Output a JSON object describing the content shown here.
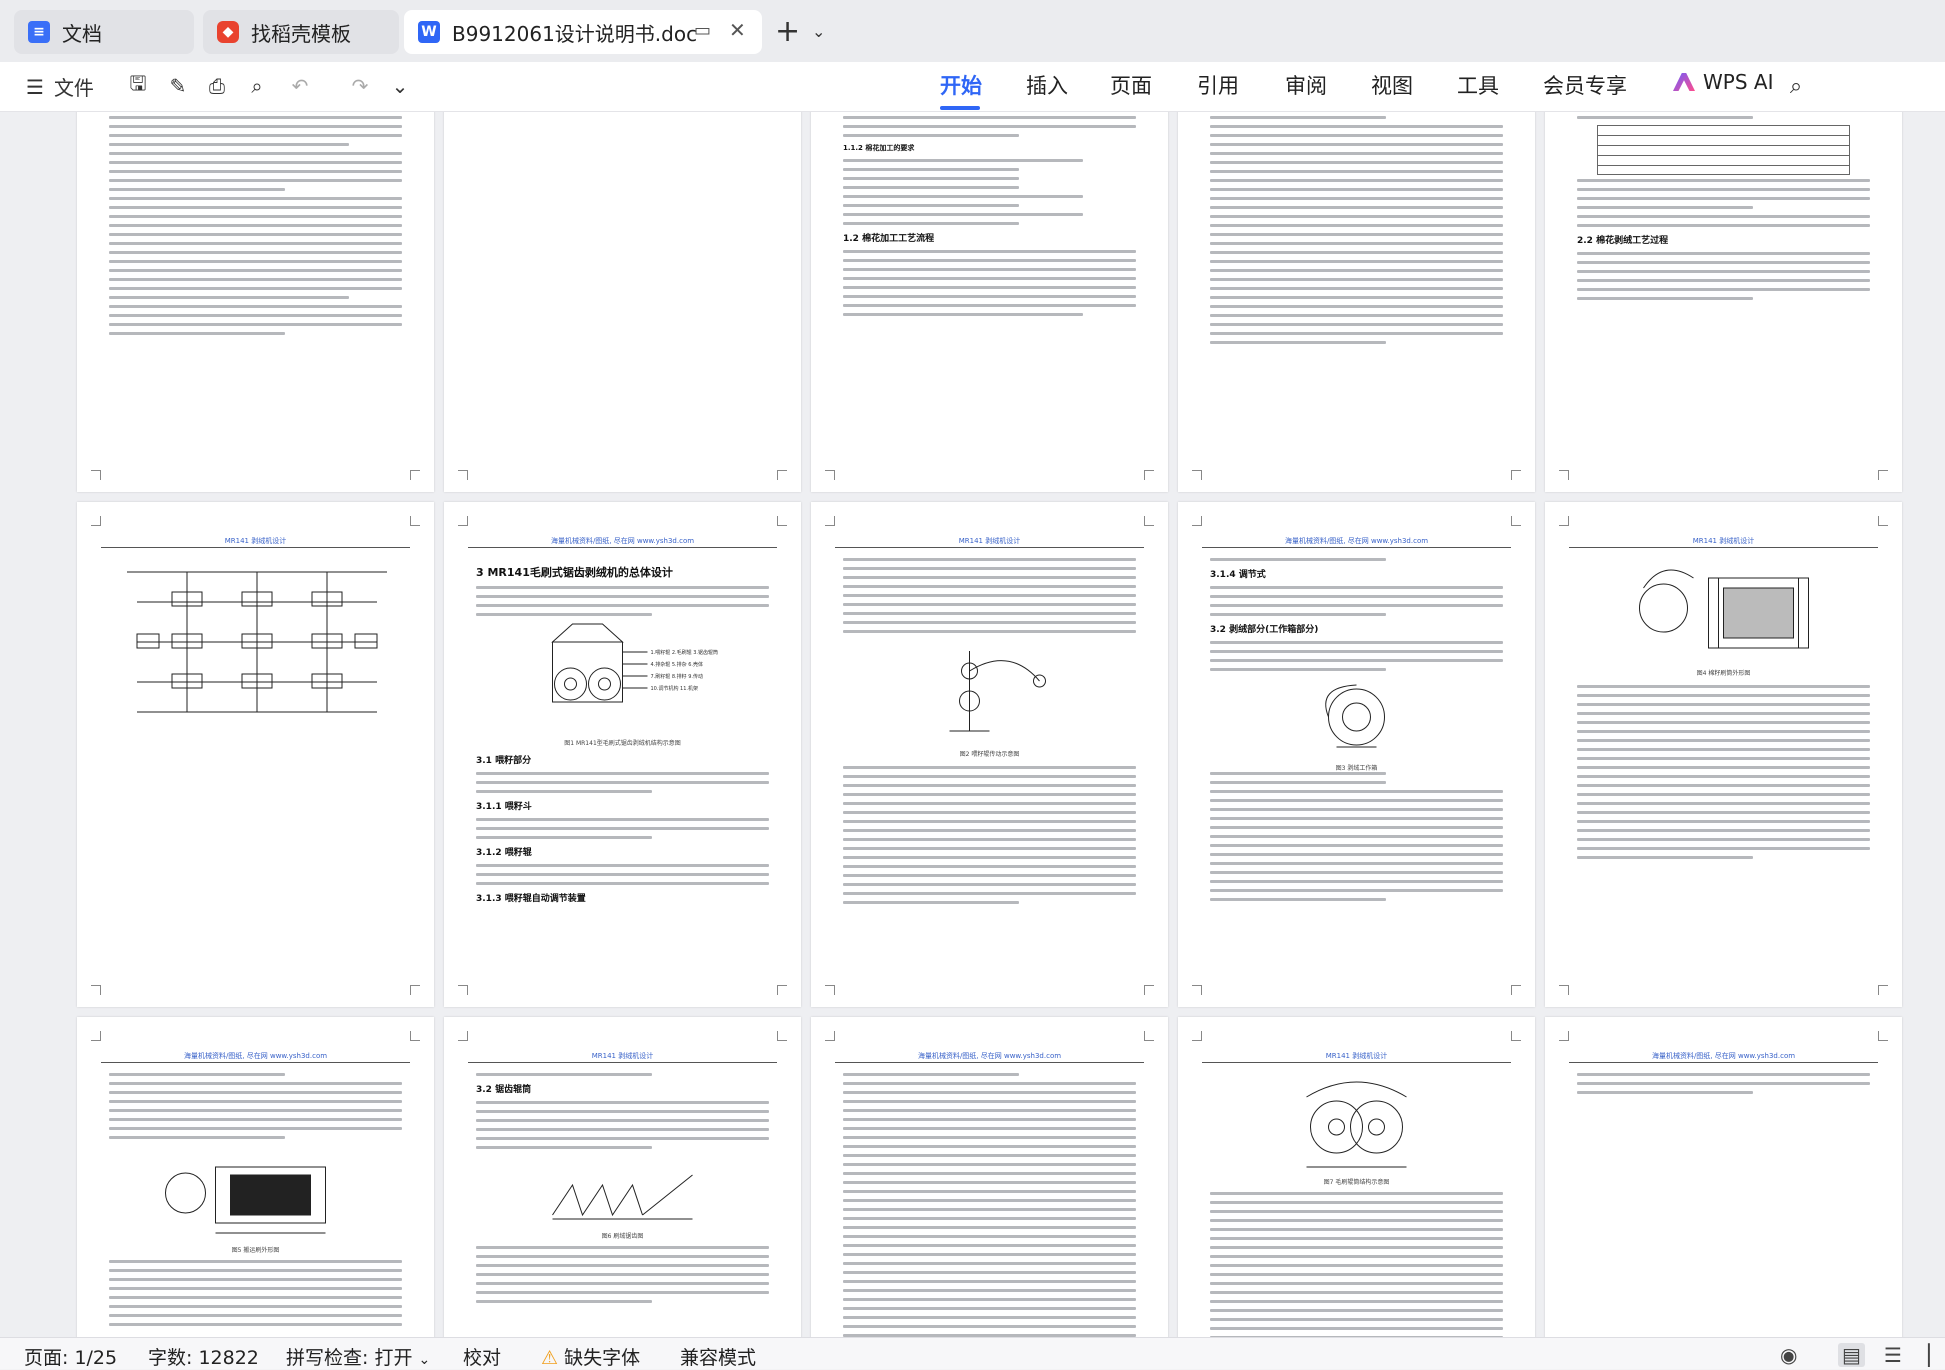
{
  "tabs": [
    {
      "label": "文档",
      "icon": "docs-icon"
    },
    {
      "label": "找稻壳模板",
      "icon": "docer-template-icon"
    },
    {
      "label": "B9912061设计说明书.doc",
      "icon": "word-doc-icon"
    }
  ],
  "toolbar": {
    "file_label": "文件",
    "menus": [
      "开始",
      "插入",
      "页面",
      "引用",
      "审阅",
      "视图",
      "工具",
      "会员专享"
    ],
    "active_menu": "开始",
    "wps_ai_label": "WPS AI"
  },
  "document": {
    "header_text": "海量机械资料/图纸, 尽在网 www.ysh3d.com",
    "page2_title": "3  MR141毛刷式锯齿剥绒机的总体设计",
    "headings": {
      "p2_3_1": "3.1 喂籽部分",
      "p2_3_1_1": "3.1.1 喂籽斗",
      "p2_3_1_2": "3.1.2 喂籽辊",
      "p2_3_1_3": "3.1.3 喂籽辊自动调节装置",
      "p4_3_1_4": "3.1.4 调节式",
      "p4_3_2": "3.2 剥绒部分(工作箱部分)",
      "p0_1_2": "1.2 棉花加工工艺流程",
      "p4_2_2": "2.2 棉花剥绒工艺过程",
      "p5_3_2": "3.2 锯齿辊筒"
    },
    "figure_captions": {
      "p2": "图1  MR141型毛刷式锯齿剥绒机结构示意图",
      "p3": "图2  喂籽辊传动示意图",
      "p4": "图3  剥绒工作箱",
      "p5": "图4  棉籽刷筒外形图",
      "p6": "图5  搬运刷外形图",
      "p7": "图6  刷绒锯齿图",
      "p8": "图7  毛刷辊筒结构示意图"
    }
  },
  "status": {
    "page": "页面: 1/25",
    "word_count": "字数: 12822",
    "spellcheck": "拼写检查: 打开",
    "proofread": "校对",
    "missing_font": "缺失字体",
    "compat_mode": "兼容模式"
  }
}
